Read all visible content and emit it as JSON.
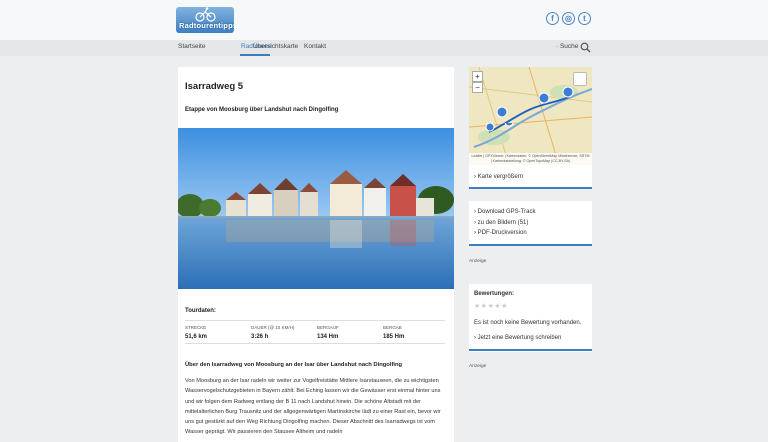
{
  "header": {
    "logo_text": "Radtourentipps.de",
    "social": [
      {
        "icon": "facebook-icon",
        "glyph": "f"
      },
      {
        "icon": "instagram-icon",
        "glyph": "◎"
      },
      {
        "icon": "twitter-icon",
        "glyph": "t"
      }
    ]
  },
  "nav": {
    "items": [
      "Startseite",
      "Radtouren",
      "Übersichtskarte",
      "Kontakt"
    ],
    "active": "Radtouren",
    "search_label": "· Suche"
  },
  "article": {
    "title": "Isarradweg 5",
    "subtitle": "Etappe von Moosburg über Landshut nach Dingolfing",
    "tour_data_heading": "Tourdaten:",
    "stats": [
      {
        "label": "STRECKE",
        "value": "51,6 km"
      },
      {
        "label": "DAUER (@ 15 km/h)",
        "value": "3:26 h"
      },
      {
        "label": "BERGAUF",
        "value": "134 Hm"
      },
      {
        "label": "BERGAB",
        "value": "185 Hm"
      }
    ],
    "section_heading": "Über den Isarradweg von Moosburg an der Isar über Landshut nach Dingolfing",
    "body": "Von Moosburg an der Isar radeln wir weiter zur Vogelfreistätte Mittlere Isarstauseen, die zu wichtigsten Wasservogelschutzgebieten in Bayern zählt. Bei Eching lassen wir die Gewässer erst einmal hinter uns und wir folgen dem Radweg entlang der B 11 nach Landshut hinein. Die schöne Altstadt mit der mittelalterlichen Burg Trausnitz und der allgegenwärtigen Martinskirche lädt zu einer Rast ein, bevor wir uns gut gestärkt auf den Weg Richtung Dingolfing machen. Dieser Abschnitt des Isarradwegs ist vom Wasser geprägt. Wir passieren den Stausee Altheim und radeln"
  },
  "map": {
    "zoom_in": "+",
    "zoom_out": "−",
    "attribution": "Leaflet | GPXViewer | Kartendaten: © OpenStreetMap Mitwirkende, SRTM | Kartendarstellung: © OpenTopoMap (CC-BY-SA)"
  },
  "sidebar": {
    "enlarge_map": "› Karte vergrößern",
    "downloads": [
      "› Download GPS-Track",
      "› zu den Bildern (51)",
      "› PDF-Druckversion"
    ],
    "ad_label": "Anzeige",
    "rating_heading": "Bewertungen:",
    "rating_stars": "★★★★★",
    "no_rating": "Es ist noch keine Bewertung vorhanden.",
    "write_rating": "› Jetzt eine Bewertung schreiben",
    "ad_label_2": "Anzeige"
  },
  "colors": {
    "accent": "#3d7ec1",
    "background": "#eceef0"
  }
}
